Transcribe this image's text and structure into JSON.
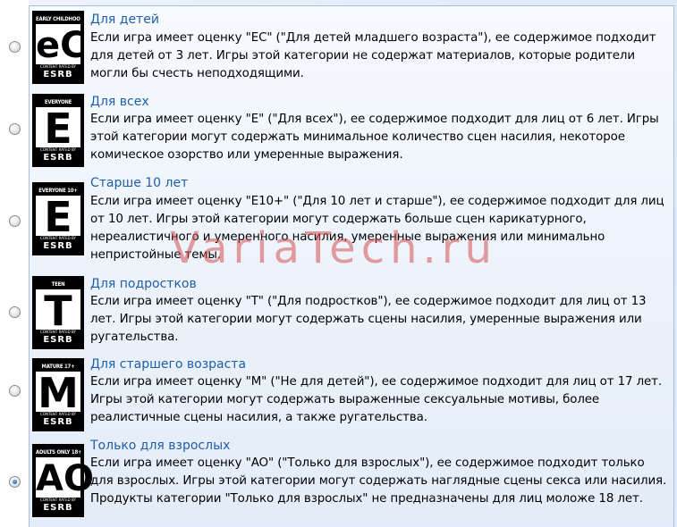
{
  "ratings": [
    {
      "logo": {
        "top": "EARLY CHILDHOOD",
        "letter": "eC",
        "bottom_small": "CONTENT RATED BY",
        "bottom": "ESRB"
      },
      "title": "Для детей",
      "description": "Если игра имеет оценку \"EC\" (\"Для детей младшего возраста\"), ее содержимое подходит для детей от 3 лет.  Игры этой категории не содержат материалов, которые родители могли бы счесть неподходящими.",
      "selected": false
    },
    {
      "logo": {
        "top": "EVERYONE",
        "letter": "E",
        "bottom_small": "CONTENT RATED BY",
        "bottom": "ESRB"
      },
      "title": "Для всех",
      "description": "Если игра имеет оценку \"E\" (\"Для всех\"), ее содержимое подходит для лиц от 6 лет. Игры этой категории могут содержать минимальное количество сцен насилия, некоторое комическое озорство или умеренные выражения.",
      "selected": false
    },
    {
      "logo": {
        "top": "EVERYONE 10+",
        "letter": "E",
        "bottom_small": "CONTENT RATED BY",
        "bottom": "ESRB"
      },
      "title": "Старше 10 лет",
      "description": "Если игра имеет оценку \"E10+\" (\"Для 10 лет и старше\"), ее содержимое подходит для лиц от 10 лет. Игры этой категории могут содержать больше сцен карикатурного, нереалистичного и умеренного насилия, умеренные выражения или минимально непристойные темы.",
      "selected": false
    },
    {
      "logo": {
        "top": "TEEN",
        "letter": "T",
        "bottom_small": "CONTENT RATED BY",
        "bottom": "ESRB"
      },
      "title": "Для подростков",
      "description": "Если игра имеет оценку \"T\" (\"Для подростков\"), ее содержимое подходит для лиц от 13 лет.  Игры этой категории могут содержать сцены насилия, умеренные выражения или ругательства.",
      "selected": false
    },
    {
      "logo": {
        "top": "MATURE 17+",
        "letter": "M",
        "bottom_small": "CONTENT RATED BY",
        "bottom": "ESRB"
      },
      "title": "Для старшего возраста",
      "description": "Если игра имеет оценку \"M\" (\"Не для детей\"), ее содержимое подходит для лиц от 17 лет.  Игры этой категории могут содержать выраженные сексуальные мотивы, более реалистичные сцены насилия, а также ругательства.",
      "selected": false
    },
    {
      "logo": {
        "top": "ADULTS ONLY 18+",
        "letter": "AO",
        "bottom_small": "CONTENT RATED BY",
        "bottom": "ESRB"
      },
      "title": "Только для взрослых",
      "description": "Если игра имеет оценку \"AO\" (\"Только для взрослых\"), ее содержимое подходит только для взрослых.  Игры этой категории могут содержать наглядные сцены секса или насилия.  Продукты категории \"Только для взрослых\" не предназначены для лиц моложе 18 лет.",
      "selected": true
    }
  ],
  "watermark": "VariaTech.ru",
  "colors": {
    "title": "#1f5fa8",
    "watermark": "#d64e4e",
    "panel": "#e3ecf8"
  }
}
